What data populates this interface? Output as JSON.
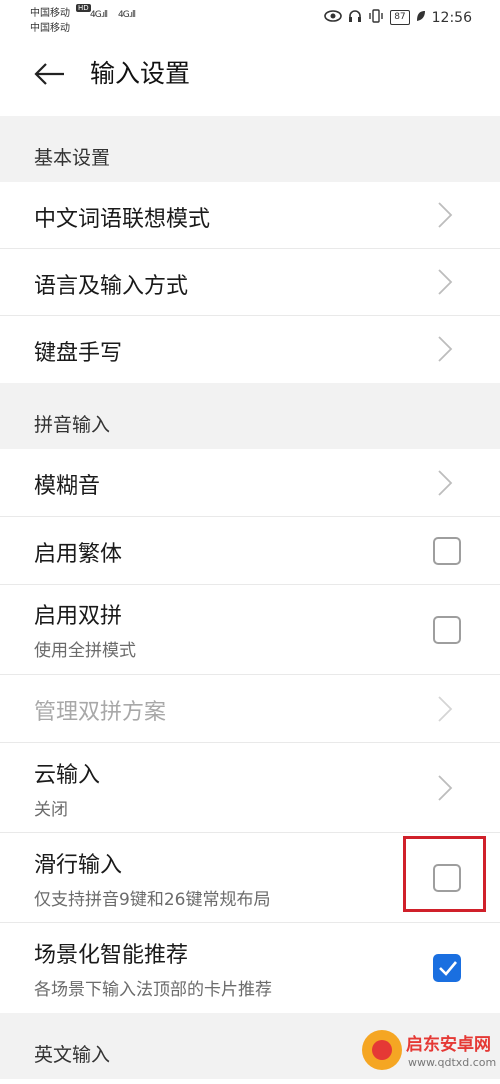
{
  "status_bar": {
    "carrier1": "中国移动",
    "carrier2": "中国移动",
    "hd": "HD",
    "signal1": "4G.ıll",
    "signal2": "4G.ıll",
    "battery": "87",
    "time": "12:56",
    "icons": [
      "eye-icon",
      "headphone-icon",
      "vibrate-icon",
      "leaf-icon"
    ]
  },
  "header": {
    "title": "输入设置"
  },
  "sections": {
    "basic": {
      "title": "基本设置",
      "items": [
        {
          "label": "中文词语联想模式"
        },
        {
          "label": "语言及输入方式"
        },
        {
          "label": "键盘手写"
        }
      ]
    },
    "pinyin": {
      "title": "拼音输入",
      "items": [
        {
          "label": "模糊音"
        },
        {
          "label": "启用繁体",
          "checked": false
        },
        {
          "label": "启用双拼",
          "sub": "使用全拼模式",
          "checked": false
        },
        {
          "label": "管理双拼方案",
          "disabled": true
        },
        {
          "label": "云输入",
          "sub": "关闭"
        },
        {
          "label": "滑行输入",
          "sub": "仅支持拼音9键和26键常规布局",
          "checked": false
        },
        {
          "label": "场景化智能推荐",
          "sub": "各场景下输入法顶部的卡片推荐",
          "checked": true
        }
      ]
    },
    "english": {
      "title": "英文输入"
    }
  },
  "watermark": {
    "name": "启东安卓网",
    "url": "www.qdtxd.com"
  },
  "colors": {
    "accent": "#1a6fe0",
    "highlight": "#d0202a",
    "section_bg": "#f2f2f2"
  }
}
